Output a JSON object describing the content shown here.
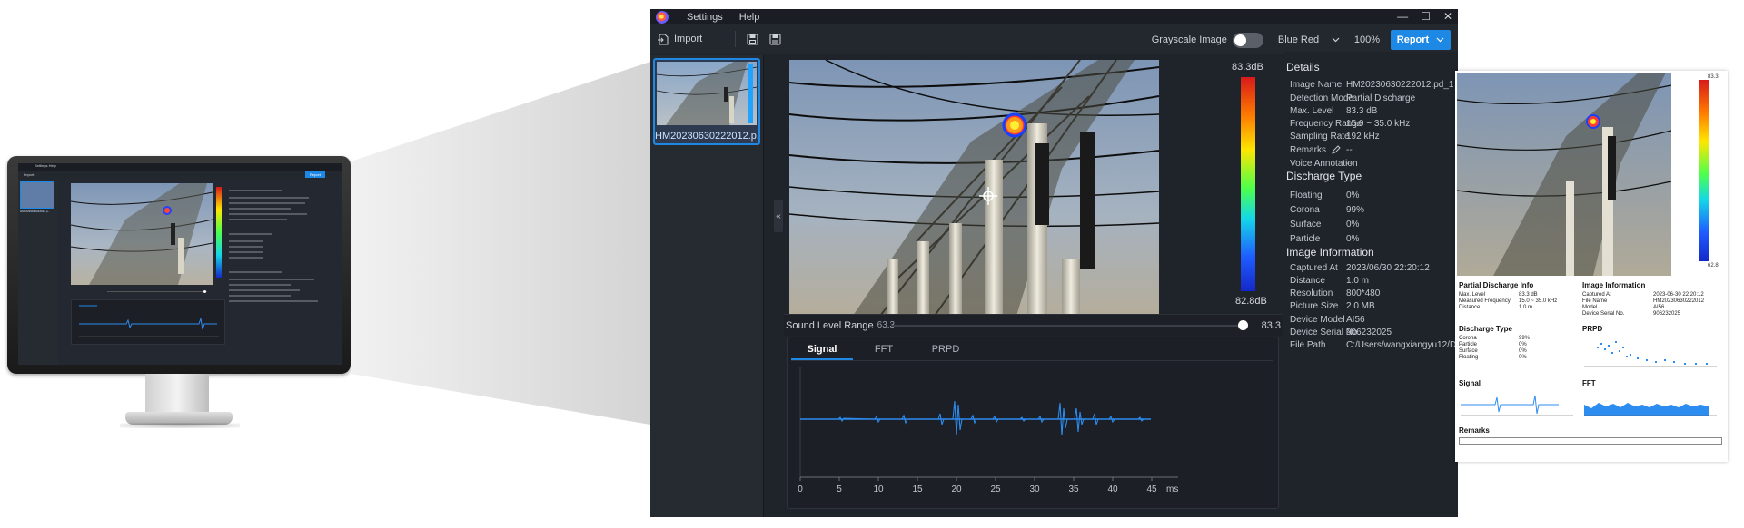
{
  "app": {
    "menu": [
      "Settings",
      "Help"
    ],
    "window_controls": [
      "—",
      "☐",
      "✕"
    ],
    "toolbar": {
      "import_label": "Import",
      "grayscale_label": "Grayscale Image",
      "grayscale_on": false,
      "palette_value": "Blue Red",
      "zoom": "100%",
      "report_label": "Report"
    },
    "thumbnail": {
      "label": "HM20230630222012.p..."
    },
    "colorbar": {
      "max": "83.3dB",
      "min": "82.8dB"
    },
    "sound_range": {
      "label": "Sound Level Range",
      "min": "63.3",
      "max": "83.3",
      "level": 0.97
    },
    "wave": {
      "tabs": [
        "Signal",
        "FFT",
        "PRPD"
      ],
      "active_tab": "Signal",
      "x_ticks": [
        "0",
        "5",
        "10",
        "15",
        "20",
        "25",
        "30",
        "35",
        "40",
        "45"
      ],
      "unit": "ms"
    },
    "details": {
      "title": "Details",
      "rows": [
        {
          "k": "Image Name",
          "v": "HM20230630222012.pd_1"
        },
        {
          "k": "Detection Mode",
          "v": "Partial Discharge"
        },
        {
          "k": "Max. Level",
          "v": "83.3 dB"
        },
        {
          "k": "Frequency Range",
          "v": "15.0 ~ 35.0 kHz"
        },
        {
          "k": "Sampling Rate",
          "v": "192 kHz"
        },
        {
          "k": "Remarks",
          "v": "--"
        },
        {
          "k": "Voice Annotation",
          "v": "--"
        }
      ]
    },
    "discharge": {
      "title": "Discharge Type",
      "rows": [
        {
          "k": "Floating",
          "v": "0%"
        },
        {
          "k": "Corona",
          "v": "99%"
        },
        {
          "k": "Surface",
          "v": "0%"
        },
        {
          "k": "Particle",
          "v": "0%"
        }
      ]
    },
    "image_info": {
      "title": "Image Information",
      "rows": [
        {
          "k": "Captured At",
          "v": "2023/06/30 22:20:12"
        },
        {
          "k": "Distance",
          "v": "1.0 m"
        },
        {
          "k": "Resolution",
          "v": "800*480"
        },
        {
          "k": "Picture Size",
          "v": "2.0 MB"
        },
        {
          "k": "Device Model",
          "v": "AI56"
        },
        {
          "k": "Device Serial No.",
          "v": "906232025"
        },
        {
          "k": "File Path",
          "v": "C:/Users/wangxiangyu12/De..."
        }
      ]
    }
  },
  "report": {
    "bar_max": "83.3",
    "bar_min": "62.8",
    "pd_title": "Partial Discharge Info",
    "pd_rows": [
      {
        "k": "Max. Level",
        "v": "83.3 dB"
      },
      {
        "k": "Measured Frequency",
        "v": "15.0 ~ 35.0 kHz"
      },
      {
        "k": "Distance",
        "v": "1.0 m"
      }
    ],
    "ii_title": "Image Information",
    "ii_rows": [
      {
        "k": "Captured At",
        "v": "2023-06-30 22:20:12"
      },
      {
        "k": "File Name",
        "v": "HM20230630222012"
      },
      {
        "k": "Model",
        "v": "AI56"
      },
      {
        "k": "Device Serial No.",
        "v": "906232025"
      }
    ],
    "dt_title": "Discharge Type",
    "dt_rows": [
      {
        "k": "Corona",
        "v": "99%"
      },
      {
        "k": "Particle",
        "v": "0%"
      },
      {
        "k": "Surface",
        "v": "0%"
      },
      {
        "k": "Floating",
        "v": "0%"
      }
    ],
    "prpd_title": "PRPD",
    "signal_title": "Signal",
    "fft_title": "FFT",
    "remarks_title": "Remarks"
  },
  "mini": {
    "menu": "Settings  Help",
    "import": "Import",
    "report": "Report",
    "thumb": "HM20230630222012.p..."
  }
}
